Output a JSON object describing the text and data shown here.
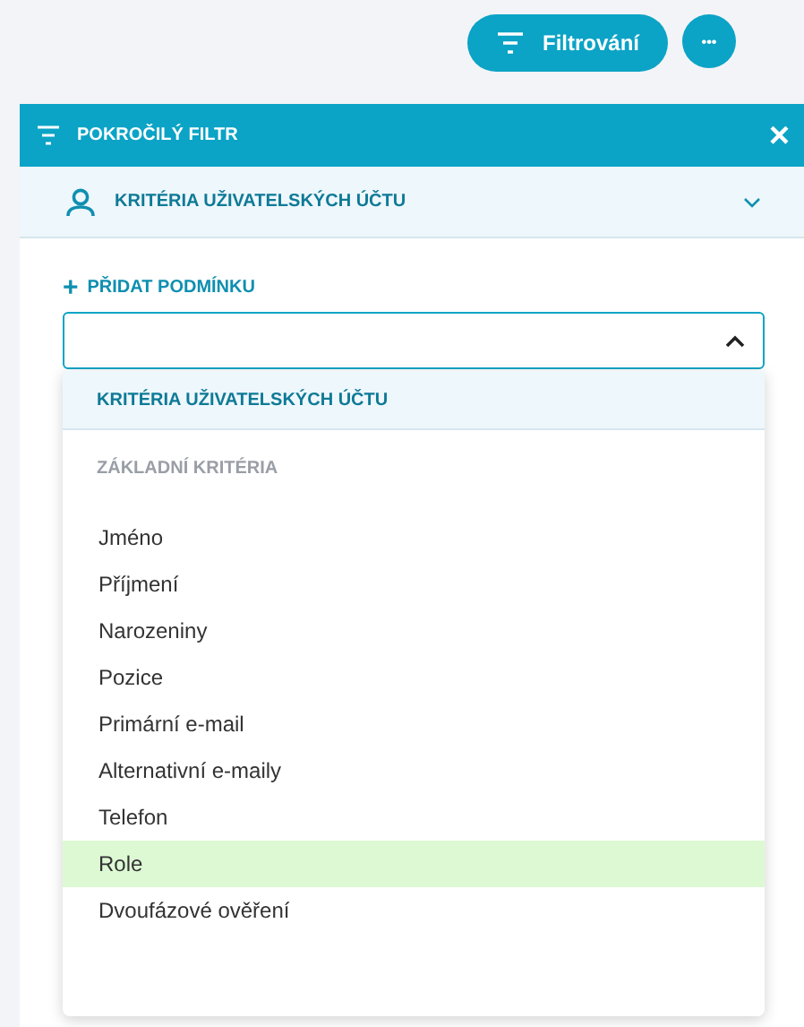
{
  "toolbar": {
    "filter_button": "Filtrování",
    "more_button": "•••"
  },
  "panel": {
    "title": "POKROČILÝ FILTR",
    "close": "×",
    "section": {
      "title": "KRITÉRIA UŽIVATELSKÝCH ÚČTU",
      "expanded": false
    },
    "add_condition": {
      "label": "PŘIDAT PODMÍNKU",
      "icon": "+"
    },
    "select": {
      "open": true
    },
    "dropdown": {
      "group": "KRITÉRIA UŽIVATELSKÝCH ÚČTU",
      "subheader": "ZÁKLADNÍ KRITÉRIA",
      "items": [
        {
          "label": "Jméno",
          "highlighted": false
        },
        {
          "label": "Příjmení",
          "highlighted": false
        },
        {
          "label": "Narozeniny",
          "highlighted": false
        },
        {
          "label": "Pozice",
          "highlighted": false
        },
        {
          "label": "Primární e-mail",
          "highlighted": false
        },
        {
          "label": "Alternativní e-maily",
          "highlighted": false
        },
        {
          "label": "Telefon",
          "highlighted": false
        },
        {
          "label": "Role",
          "highlighted": true
        },
        {
          "label": "Dvoufázové ověření",
          "highlighted": false
        }
      ]
    }
  }
}
